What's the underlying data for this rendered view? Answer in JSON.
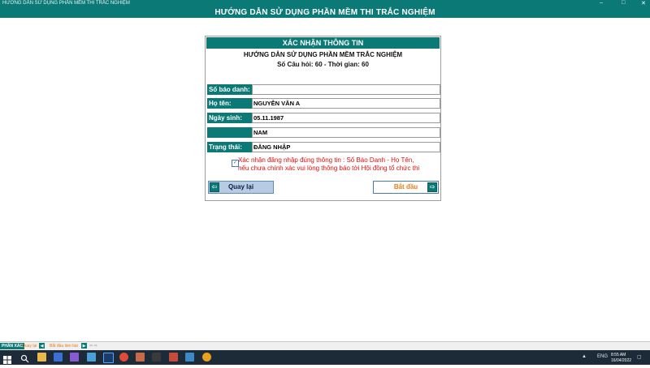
{
  "window": {
    "title": "HƯỚNG DẪN SỬ DỤNG PHẦN MỀM THI TRẮC NGHIỆM",
    "heading": "HƯỚNG DẪN SỬ DỤNG PHẦN MỀM THI TRẮC NGHIỆM",
    "controls": {
      "minimize": "–",
      "maximize": "□",
      "close": "✕"
    }
  },
  "dialog": {
    "header": "XÁC NHẬN THÔNG TIN",
    "exam_title": "HƯỚNG DẪN SỬ DỤNG PHẦN MỀM TRẮC NGHIỆM",
    "exam_info": "Số Câu hỏi: 60 - Thời gian: 60",
    "fields": [
      {
        "label": "Số báo danh:",
        "value": ""
      },
      {
        "label": "Họ tên:",
        "value": "NGUYỄN VĂN A"
      },
      {
        "label": "Ngày sinh:",
        "value": "05.11.1987"
      },
      {
        "label": "",
        "value": "NAM"
      },
      {
        "label": "Trạng thái:",
        "value": "ĐĂNG NHẬP"
      }
    ],
    "confirm_checked": "✓",
    "notice_line1": "Xác nhận đăng nhập đúng thông tin : Số Báo Danh - Họ Tên,",
    "notice_line2": "nếu chưa chính xác vui lòng thông báo tới Hội đồng tổ chức thi",
    "back_button": "Quay lại",
    "start_button": "Bắt đầu",
    "back_arrow": "⇦",
    "start_arrow": "⇨"
  },
  "sheet_bar": {
    "active_tab": "PHẦN XÁC",
    "back_tab": "Quay lại",
    "start_tab": "Bắt đầu làm bài",
    "nav": "⇦ ⇨"
  },
  "taskbar": {
    "language": "ENG",
    "time": "8:55 AM",
    "date": "16/04/2022"
  },
  "colors": {
    "accent": "#0b7a77",
    "warning_text": "#e01010",
    "start_text": "#ee7b10",
    "back_button_bg": "#b7cbe4"
  }
}
